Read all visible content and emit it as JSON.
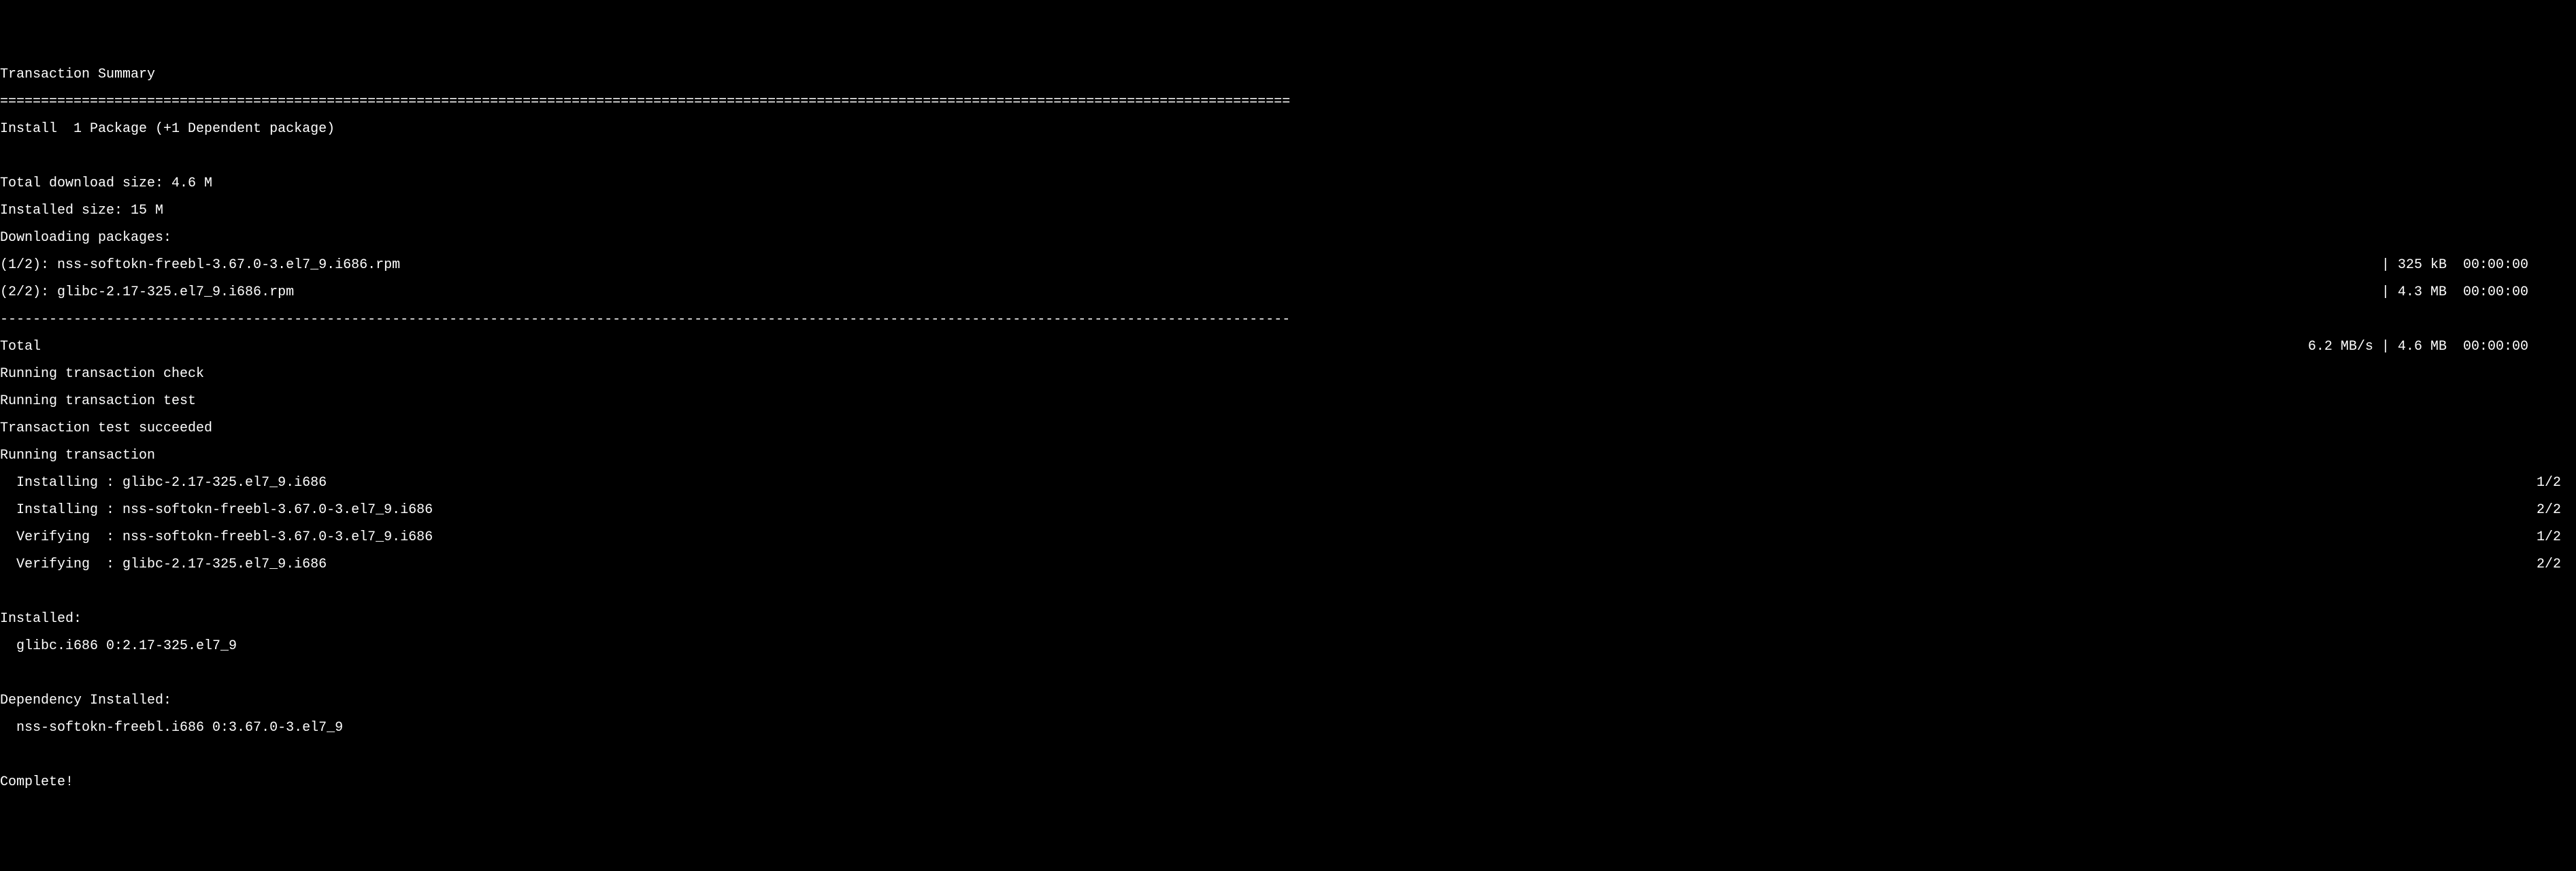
{
  "header": "Transaction Summary",
  "divider_eq": "==============================================================================================================================================================",
  "install_line": "Install  1 Package (+1 Dependent package)",
  "total_download": "Total download size: 4.6 M",
  "installed_size": "Installed size: 15 M",
  "downloading": "Downloading packages:",
  "downloads": [
    {
      "left": "(1/2): nss-softokn-freebl-3.67.0-3.el7_9.i686.rpm",
      "right": "| 325 kB  00:00:00     "
    },
    {
      "left": "(2/2): glibc-2.17-325.el7_9.i686.rpm",
      "right": "| 4.3 MB  00:00:00     "
    }
  ],
  "divider_dash": "--------------------------------------------------------------------------------------------------------------------------------------------------------------",
  "total_line": {
    "left": "Total",
    "right": "6.2 MB/s | 4.6 MB  00:00:00     "
  },
  "running_check": "Running transaction check",
  "running_test": "Running transaction test",
  "test_succeeded": "Transaction test succeeded",
  "running_tx": "Running transaction",
  "tx_steps": [
    {
      "left": "  Installing : glibc-2.17-325.el7_9.i686",
      "right": "1/2 "
    },
    {
      "left": "  Installing : nss-softokn-freebl-3.67.0-3.el7_9.i686",
      "right": "2/2 "
    },
    {
      "left": "  Verifying  : nss-softokn-freebl-3.67.0-3.el7_9.i686",
      "right": "1/2 "
    },
    {
      "left": "  Verifying  : glibc-2.17-325.el7_9.i686",
      "right": "2/2 "
    }
  ],
  "installed_header": "Installed:",
  "installed_pkg": "  glibc.i686 0:2.17-325.el7_9",
  "dep_installed_header": "Dependency Installed:",
  "dep_installed_pkg": "  nss-softokn-freebl.i686 0:3.67.0-3.el7_9",
  "complete": "Complete!"
}
